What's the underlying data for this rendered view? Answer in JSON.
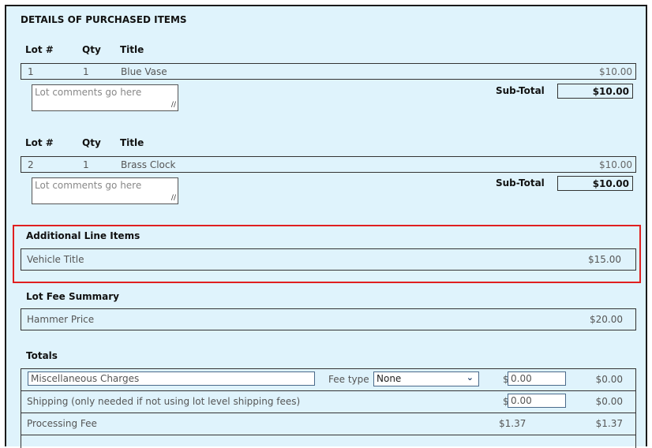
{
  "section_title": "DETAILS OF PURCHASED ITEMS",
  "lot_headers": {
    "lot": "Lot #",
    "qty": "Qty",
    "title": "Title"
  },
  "lots": [
    {
      "lot": "1",
      "qty": "1",
      "title": "Blue Vase",
      "amount": "$10.00",
      "comment_placeholder": "Lot comments go here",
      "subtotal_label": "Sub-Total",
      "subtotal": "$10.00"
    },
    {
      "lot": "2",
      "qty": "1",
      "title": "Brass Clock",
      "amount": "$10.00",
      "comment_placeholder": "Lot comments go here",
      "subtotal_label": "Sub-Total",
      "subtotal": "$10.00"
    }
  ],
  "additional": {
    "title": "Additional Line Items",
    "item_label": "Vehicle Title",
    "item_amount": "$15.00"
  },
  "lot_fee": {
    "title": "Lot Fee Summary",
    "item_label": "Hammer Price",
    "item_amount": "$20.00"
  },
  "totals": {
    "title": "Totals",
    "misc_value": "Miscellaneous Charges",
    "fee_type_label": "Fee type",
    "fee_type_value": "None",
    "misc_currency": "$",
    "misc_input": "0.00",
    "misc_amount": "$0.00",
    "shipping_label": "Shipping (only needed if not using lot level shipping fees)",
    "shipping_currency": "$",
    "shipping_input": "0.00",
    "shipping_amount": "$0.00",
    "processing_label": "Processing Fee",
    "processing_fee": "$1.37",
    "processing_amount": "$1.37"
  },
  "colors": {
    "background": "#dff3fc",
    "highlight": "#e02020"
  }
}
